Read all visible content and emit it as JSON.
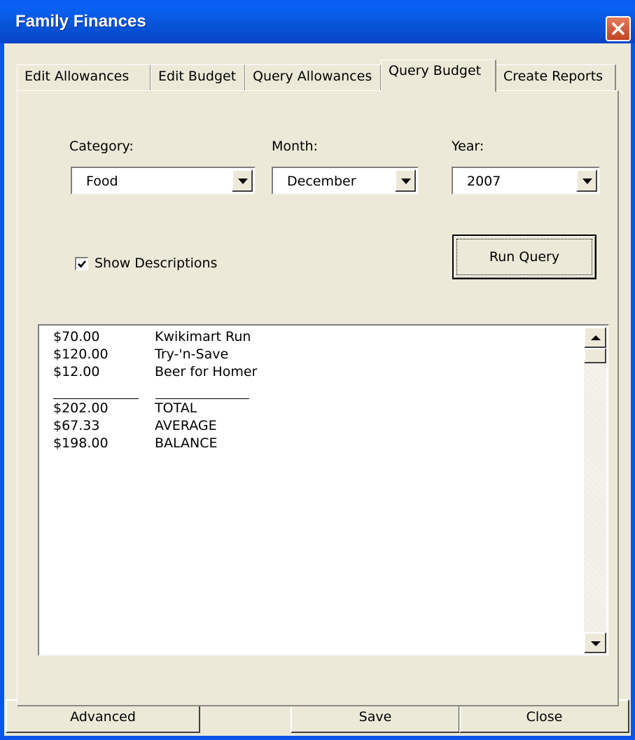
{
  "window": {
    "title": "Family Finances"
  },
  "tabs": [
    {
      "label": "Edit Allowances",
      "active": false
    },
    {
      "label": "Edit Budget",
      "active": false
    },
    {
      "label": "Query Allowances",
      "active": false
    },
    {
      "label": "Query Budget",
      "active": true
    },
    {
      "label": "Create Reports",
      "active": false
    }
  ],
  "query": {
    "category_label": "Category:",
    "category_value": "Food",
    "month_label": "Month:",
    "month_value": "December",
    "year_label": "Year:",
    "year_value": "2007",
    "show_descriptions_label": "Show Descriptions",
    "show_descriptions_checked": true,
    "run_query_label": "Run Query"
  },
  "results": {
    "entries": [
      {
        "amount": "$70.00",
        "description": "Kwikimart Run"
      },
      {
        "amount": "$120.00",
        "description": "Try-'n-Save"
      },
      {
        "amount": "$12.00",
        "description": "Beer for Homer"
      }
    ],
    "summary": [
      {
        "amount": "$202.00",
        "description": "TOTAL"
      },
      {
        "amount": "$67.33",
        "description": "AVERAGE"
      },
      {
        "amount": "$198.00",
        "description": "BALANCE"
      }
    ]
  },
  "footer": {
    "advanced_label": "Advanced",
    "save_label": "Save",
    "close_label": "Close"
  },
  "colors": {
    "titlebar": "#0A5AEF",
    "dialog_face": "#ECE9D8",
    "close_button": "#D5532D"
  },
  "icons": {
    "close": "close-icon",
    "checkbox": "checkmark-icon",
    "dropdown": "chevron-down-icon",
    "scroll_up": "scroll-up-arrow-icon",
    "scroll_down": "scroll-down-arrow-icon"
  }
}
